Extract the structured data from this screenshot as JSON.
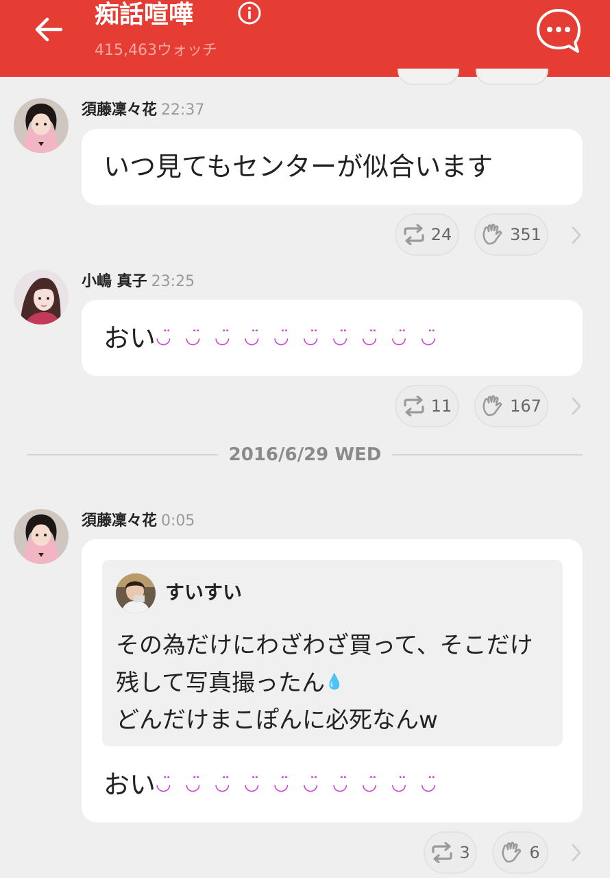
{
  "header": {
    "title": "痴話喧嘩",
    "watch_count": "415,463ウォッチ",
    "accent": "#e53c33"
  },
  "posts": [
    {
      "author": "須藤凜々花",
      "time": "22:37",
      "text": "いつ見てもセンターが似合います",
      "retweets": "24",
      "claps": "351"
    },
    {
      "author": "小嶋 真子",
      "time": "23:25",
      "text": "おい",
      "emoji": "◡̈ ◡̈ ◡̈ ◡̈ ◡̈ ◡̈ ◡̈ ◡̈ ◡̈ ◡̈",
      "retweets": "11",
      "claps": "167"
    },
    {
      "author": "須藤凜々花",
      "time": "0:05",
      "quote": {
        "author": "すいすい",
        "line1": "その為だけにわざわざ買って、そこだけ",
        "line2": "残して写真撮ったん",
        "line2_emoji": "💧",
        "line3": "どんだけまこぽんに必死なんw"
      },
      "text": "おい",
      "emoji": "◡̈ ◡̈ ◡̈ ◡̈ ◡̈ ◡̈ ◡̈ ◡̈ ◡̈ ◡̈",
      "retweets": "3",
      "claps": "6"
    }
  ],
  "date_divider": "2016/6/29 WED",
  "icons": [
    "back-arrow-icon",
    "info-icon",
    "more-chat-icon",
    "retweet-icon",
    "clap-hand-icon",
    "chevron-right-icon"
  ]
}
